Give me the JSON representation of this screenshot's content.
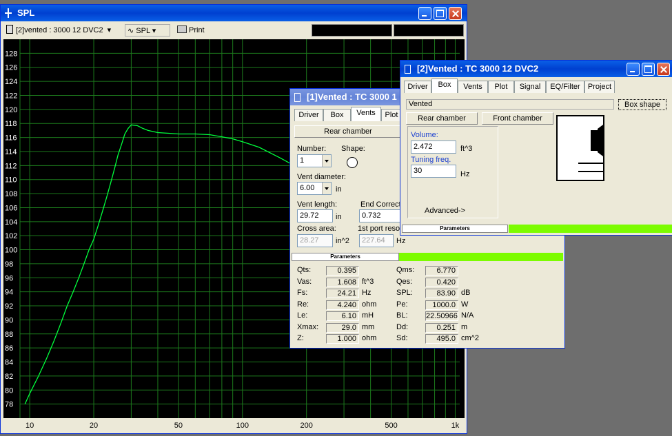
{
  "spl_window": {
    "title": "SPL",
    "driver_select": "[2]vented : 3000 12 DVC2",
    "mode_label": "SPL",
    "print_label": "Print"
  },
  "chart_data": {
    "type": "line",
    "xscale": "log",
    "xlim": [
      9,
      1050
    ],
    "ylim": [
      76,
      130
    ],
    "yticks": [
      78,
      80,
      82,
      84,
      86,
      88,
      90,
      92,
      94,
      96,
      98,
      100,
      102,
      104,
      106,
      108,
      110,
      112,
      114,
      116,
      118,
      120,
      122,
      124,
      126,
      128
    ],
    "xtick_labels": [
      "10",
      "20",
      "50",
      "100",
      "200",
      "500",
      "1k"
    ],
    "xtick_values": [
      10,
      20,
      50,
      100,
      200,
      500,
      1000
    ],
    "grid": true,
    "series": [
      {
        "color": "#00ff3c",
        "x": [
          9.5,
          10,
          11,
          12,
          13,
          14,
          15,
          16,
          17,
          18,
          19,
          20,
          21,
          22,
          23,
          24,
          25,
          26,
          27,
          28,
          29,
          30,
          32,
          34,
          36,
          40,
          45,
          50,
          55,
          60,
          70,
          80,
          90,
          100,
          120,
          150,
          180,
          200
        ],
        "y": [
          78,
          79.5,
          82,
          84.5,
          87,
          89.5,
          92,
          94,
          96,
          98,
          100,
          101.5,
          103.5,
          105.5,
          107.5,
          109.5,
          111.5,
          113.5,
          115,
          116.5,
          117.3,
          117.8,
          117.7,
          117.3,
          117,
          116.7,
          116.6,
          116.5,
          116.5,
          116.5,
          116.4,
          116.1,
          115.8,
          115.4,
          114.6,
          113.1,
          111.8,
          110.8
        ]
      }
    ]
  },
  "w1": {
    "title": "[1]Vented : TC 3000 1",
    "tabs": [
      "Driver",
      "Box",
      "Vents",
      "Plot"
    ],
    "rear_chamber": "Rear chamber",
    "number_label": "Number:",
    "number_value": "1",
    "shape_label": "Shape:",
    "vent_diameter_label": "Vent diameter:",
    "vent_diameter_value": "6.00",
    "vent_diameter_unit": "in",
    "vent_length_label": "Vent length:",
    "vent_length_value": "29.72",
    "vent_length_unit": "in",
    "end_correct_label": "End Correct",
    "end_correct_value": "0.732",
    "cross_area_label": "Cross area:",
    "cross_area_value": "28.27",
    "cross_area_unit": "in^2",
    "port_reso_label": "1st port resor",
    "port_reso_value": "227.64",
    "port_reso_unit": "Hz",
    "parameters_label": "Parameters",
    "params_left": [
      {
        "name": "Qts:",
        "value": "0.395",
        "unit": ""
      },
      {
        "name": "Vas:",
        "value": "1.608",
        "unit": "ft^3"
      },
      {
        "name": "Fs:",
        "value": "24.21",
        "unit": "Hz"
      },
      {
        "name": "Re:",
        "value": "4.240",
        "unit": "ohm"
      },
      {
        "name": "Le:",
        "value": "6.10",
        "unit": "mH"
      },
      {
        "name": "Xmax:",
        "value": "29.0",
        "unit": "mm"
      },
      {
        "name": "Z:",
        "value": "1.000",
        "unit": "ohm"
      }
    ],
    "params_right": [
      {
        "name": "Qms:",
        "value": "6.770",
        "unit": ""
      },
      {
        "name": "Qes:",
        "value": "0.420",
        "unit": ""
      },
      {
        "name": "SPL:",
        "value": "83.90",
        "unit": "dB"
      },
      {
        "name": "Pe:",
        "value": "1000.0",
        "unit": "W"
      },
      {
        "name": "BL:",
        "value": "22.50966",
        "unit": "N/A"
      },
      {
        "name": "Dd:",
        "value": "0.251",
        "unit": "m"
      },
      {
        "name": "Sd:",
        "value": "495.0",
        "unit": "cm^2"
      }
    ]
  },
  "w2": {
    "title": "[2]Vented : TC 3000 12 DVC2",
    "tabs": [
      "Driver",
      "Box",
      "Vents",
      "Plot",
      "Signal",
      "EQ/Filter",
      "Project"
    ],
    "box_type": "Vented",
    "box_shape_button": "Box shape",
    "rear_chamber": "Rear chamber",
    "front_chamber": "Front chamber",
    "volume_label": "Volume:",
    "volume_value": "2.472",
    "volume_unit": "ft^3",
    "tuning_label": "Tuning freq.",
    "tuning_value": "30",
    "tuning_unit": "Hz",
    "advanced_label": "Advanced->",
    "parameters_label": "Parameters"
  }
}
